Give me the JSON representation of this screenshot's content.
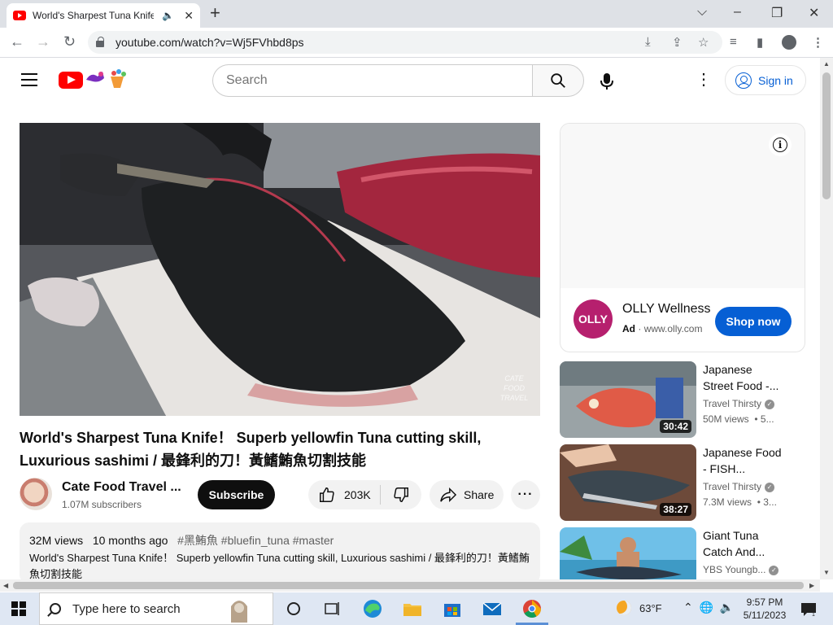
{
  "browser": {
    "tab_title": "World's Sharpest Tuna Knife",
    "new_tab": "+",
    "window_controls": {
      "minimize": "–",
      "maximize": "❐",
      "close": "✕",
      "tab_list": "⌵"
    },
    "url": "youtube.com/watch?v=Wj5FVhbd8ps",
    "nav": {
      "back": "←",
      "forward": "→",
      "reload": "↻"
    }
  },
  "masthead": {
    "search_placeholder": "Search",
    "sign_in": "Sign in"
  },
  "player": {
    "watermark_lines": [
      "CATE",
      "FOOD",
      "TRAVEL"
    ]
  },
  "video": {
    "title": "World's Sharpest Tuna Knife！ Superb yellowfin Tuna cutting skill, Luxurious sashimi / 最鋒利的刀！黃鰭鮪魚切割技能",
    "channel_name": "Cate Food Travel ...",
    "subscribers": "1.07M subscribers",
    "subscribe_label": "Subscribe",
    "likes": "203K",
    "share_label": "Share",
    "more_label": "···",
    "views": "32M views",
    "age": "10 months ago",
    "tags": "#黑鮪魚 #bluefin_tuna #master",
    "description": "World's Sharpest Tuna Knife！ Superb yellowfin Tuna cutting skill, Luxurious sashimi / 最鋒利的刀！黃鰭鮪魚切割技能"
  },
  "ad": {
    "logo_text": "OLLY",
    "title": "OLLY Wellness",
    "badge": "Ad",
    "separator": "·",
    "domain": "www.olly.com",
    "cta": "Shop now",
    "info": "i"
  },
  "recommendations": [
    {
      "title_line1": "Japanese",
      "title_line2": "Street Food -...",
      "channel": "Travel Thirsty",
      "views": "50M views",
      "meta": "• 5...",
      "duration": "30:42"
    },
    {
      "title_line1": "Japanese Food",
      "title_line2": "- FISH...",
      "channel": "Travel Thirsty",
      "views": "7.3M views",
      "meta": "• 3...",
      "duration": "38:27"
    },
    {
      "title_line1": "Giant Tuna",
      "title_line2": "Catch And...",
      "channel": "YBS Youngb...",
      "views": "",
      "meta": "",
      "duration": ""
    }
  ],
  "taskbar": {
    "search_placeholder": "Type here to search",
    "temperature": "63°F",
    "time": "9:57 PM",
    "date": "5/11/2023",
    "notification_count": "1"
  },
  "colors": {
    "brand_red": "#ff0000",
    "link_blue": "#065fd4",
    "ad_brand": "#b6206e"
  }
}
